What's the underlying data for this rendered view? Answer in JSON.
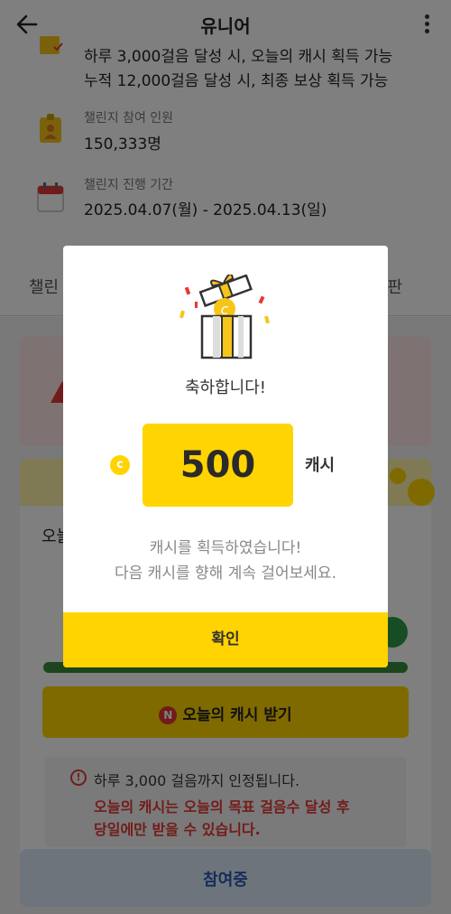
{
  "header": {
    "title": "유니어"
  },
  "condition": {
    "line1": "하루 3,000걸음 달성 시, 오늘의 캐시 획득 가능",
    "line2": "누적 12,000걸음 달성 시, 최종 보상 획득 가능"
  },
  "participants": {
    "label": "챌린지 참여 인원",
    "value": "150,333명"
  },
  "period": {
    "label": "챌린지 진행 기간",
    "value": "2025.04.07(월) - 2025.04.13(일)"
  },
  "tabs": {
    "left": "챌린",
    "right": "판"
  },
  "card": {
    "today_label": "오늘"
  },
  "cash_button": {
    "badge": "N",
    "label": "오늘의 캐시 받기"
  },
  "notice": {
    "line1": "하루 3,000 걸음까지 인정됩니다.",
    "line2": "오늘의 캐시는 오늘의 목표 걸음수 달성 후",
    "line3": "당일에만 받을 수 있습니다."
  },
  "participating_button": {
    "label": "참여중"
  },
  "modal": {
    "congrats": "축하합니다!",
    "coin_symbol": "c",
    "amount": "500",
    "unit": "캐시",
    "desc1": "캐시를 획득하였습니다!",
    "desc2": "다음 캐시를 향해 계속 걸어보세요.",
    "confirm": "확인"
  },
  "colors": {
    "accent": "#ffd400",
    "alert": "#e53935",
    "progress": "#3a8a3a",
    "participating": "#2b5bb5"
  }
}
